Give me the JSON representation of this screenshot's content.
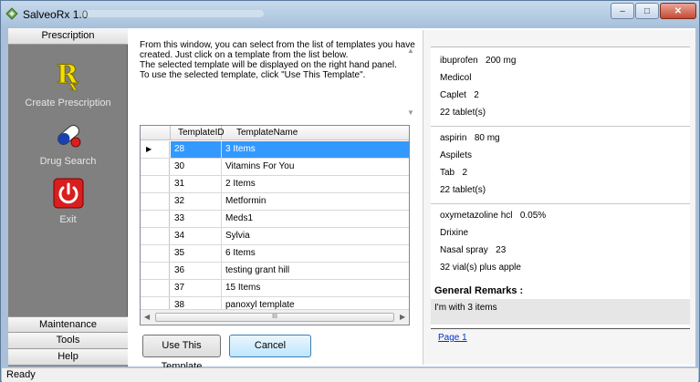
{
  "window": {
    "title": "SalveoRx 1.0"
  },
  "nav": {
    "top_header": "Prescription",
    "items": [
      {
        "label": "Create Prescription",
        "icon": "rx-icon"
      },
      {
        "label": "Drug Search",
        "icon": "pills-icon"
      },
      {
        "label": "Exit",
        "icon": "power-icon"
      }
    ],
    "bottom_headers": [
      "Maintenance",
      "Tools",
      "Help"
    ]
  },
  "intro_lines": [
    "From this window, you can select from the list of templates you have",
    "created. Just click on a template from the list below.",
    "The selected template will be displayed on the right hand panel.",
    "To use the selected template, click \"Use This Template\"."
  ],
  "grid": {
    "columns": [
      "TemplateID",
      "TemplateName"
    ],
    "rows": [
      {
        "id": "28",
        "name": "3 Items"
      },
      {
        "id": "30",
        "name": "Vitamins For You"
      },
      {
        "id": "31",
        "name": "2 Items"
      },
      {
        "id": "32",
        "name": "Metformin"
      },
      {
        "id": "33",
        "name": "Meds1"
      },
      {
        "id": "34",
        "name": "Sylvia"
      },
      {
        "id": "35",
        "name": "6 Items"
      },
      {
        "id": "36",
        "name": "testing grant hill"
      },
      {
        "id": "37",
        "name": "15 Items"
      },
      {
        "id": "38",
        "name": "panoxyl template"
      }
    ],
    "selected_index": 0,
    "scroll_thumb_label": "III"
  },
  "buttons": {
    "use_template": "Use This Template",
    "cancel": "Cancel"
  },
  "preview": {
    "medications": [
      {
        "generic": "ibuprofen",
        "strength": "200 mg",
        "brand": "Medicol",
        "form": "Caplet",
        "qty": "2",
        "dispense": "22 tablet(s)"
      },
      {
        "generic": "aspirin",
        "strength": "80 mg",
        "brand": "Aspilets",
        "form": "Tab",
        "qty": "2",
        "dispense": "22 tablet(s)"
      },
      {
        "generic": "oxymetazoline hcl",
        "strength": "0.05%",
        "brand": "Drixine",
        "form": "Nasal spray",
        "qty": "23",
        "dispense": "32 vial(s) plus apple"
      }
    ],
    "remarks_title": "General Remarks :",
    "remarks_text": "I'm with 3 items",
    "page_link": "Page 1"
  },
  "status": "Ready",
  "colors": {
    "selection": "#3399ff",
    "nav_bg": "#808080",
    "link": "#0033cc"
  }
}
